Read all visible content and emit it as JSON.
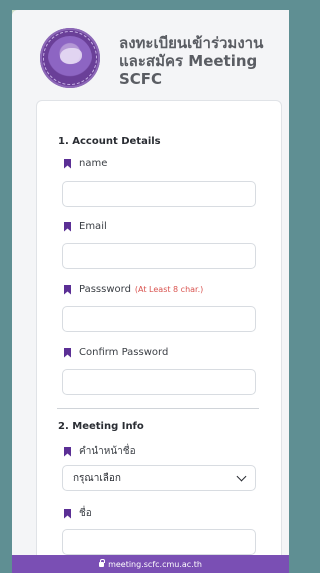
{
  "header": {
    "title": "ลงทะเบียนเข้าร่วมงาน และสมัคร Meeting SCFC"
  },
  "form": {
    "section1_title": "1. Account Details",
    "fields": [
      {
        "label": "name",
        "value": "",
        "hint": ""
      },
      {
        "label": "Email",
        "value": "",
        "hint": ""
      },
      {
        "label": "Passsword",
        "value": "",
        "hint": "(At Least 8 char.)"
      },
      {
        "label": "Confirm Password",
        "value": "",
        "hint": ""
      }
    ],
    "section2_title": "2. Meeting Info",
    "prefix_label": "คำนำหน้าชื่อ",
    "prefix_selected": "กรุณาเลือก",
    "firstname_label": "ชื่อ"
  },
  "browser": {
    "url": "meeting.scfc.cmu.ac.th"
  },
  "colors": {
    "accent": "#5b2f95",
    "background": "#5f8f93",
    "urlbar": "#7a4fb4",
    "hint": "#d9534f"
  },
  "icons": {
    "bookmark": "bookmark-icon",
    "chevron": "chevron-down-icon",
    "lock": "lock-icon"
  }
}
